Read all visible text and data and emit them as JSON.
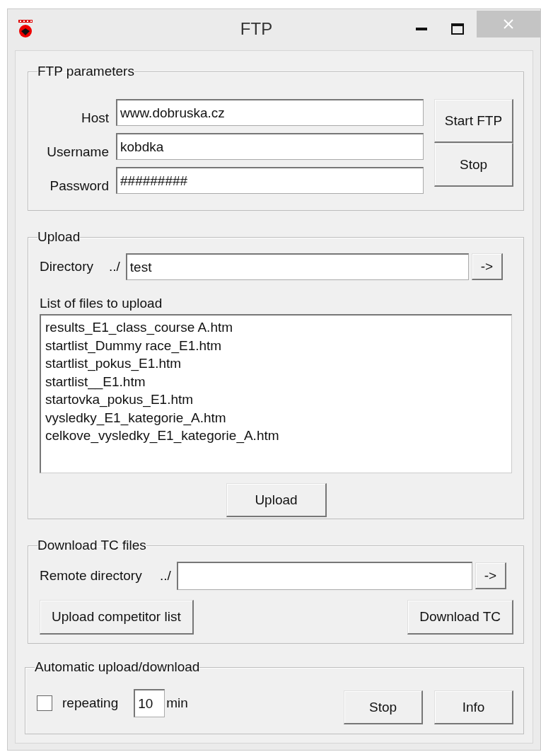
{
  "window": {
    "title": "FTP"
  },
  "ftp_parameters": {
    "title": "FTP parameters",
    "fields": [
      {
        "label": "Host",
        "value": "www.dobruska.cz"
      },
      {
        "label": "Username",
        "value": "kobdka"
      },
      {
        "label": "Password",
        "value": "#########"
      }
    ],
    "buttons": [
      "Start FTP",
      "Stop"
    ]
  },
  "upload": {
    "title": "Upload",
    "directory": {
      "label": "Directory",
      "prefix": "../",
      "value": "test",
      "button": "->"
    },
    "list_label": "List of files to upload",
    "files": [
      "results_E1_class_course A.htm",
      "startlist_Dummy race_E1.htm",
      "startlist_pokus_E1.htm",
      "startlist__E1.htm",
      "startovka_pokus_E1.htm",
      "vysledky_E1_kategorie_A.htm",
      "celkove_vysledky_E1_kategorie_A.htm"
    ],
    "button": "Upload"
  },
  "download": {
    "title": "Download TC files",
    "remote": {
      "label": "Remote directory",
      "prefix": "../",
      "button": "->"
    },
    "buttons": [
      "Upload competitor list",
      "Download TC"
    ]
  },
  "automatic": {
    "title": "Automatic upload/download",
    "repeating": {
      "label": "repeating",
      "checked": false
    },
    "interval": "10",
    "unit": "min",
    "buttons": [
      "Stop",
      "Info"
    ]
  }
}
